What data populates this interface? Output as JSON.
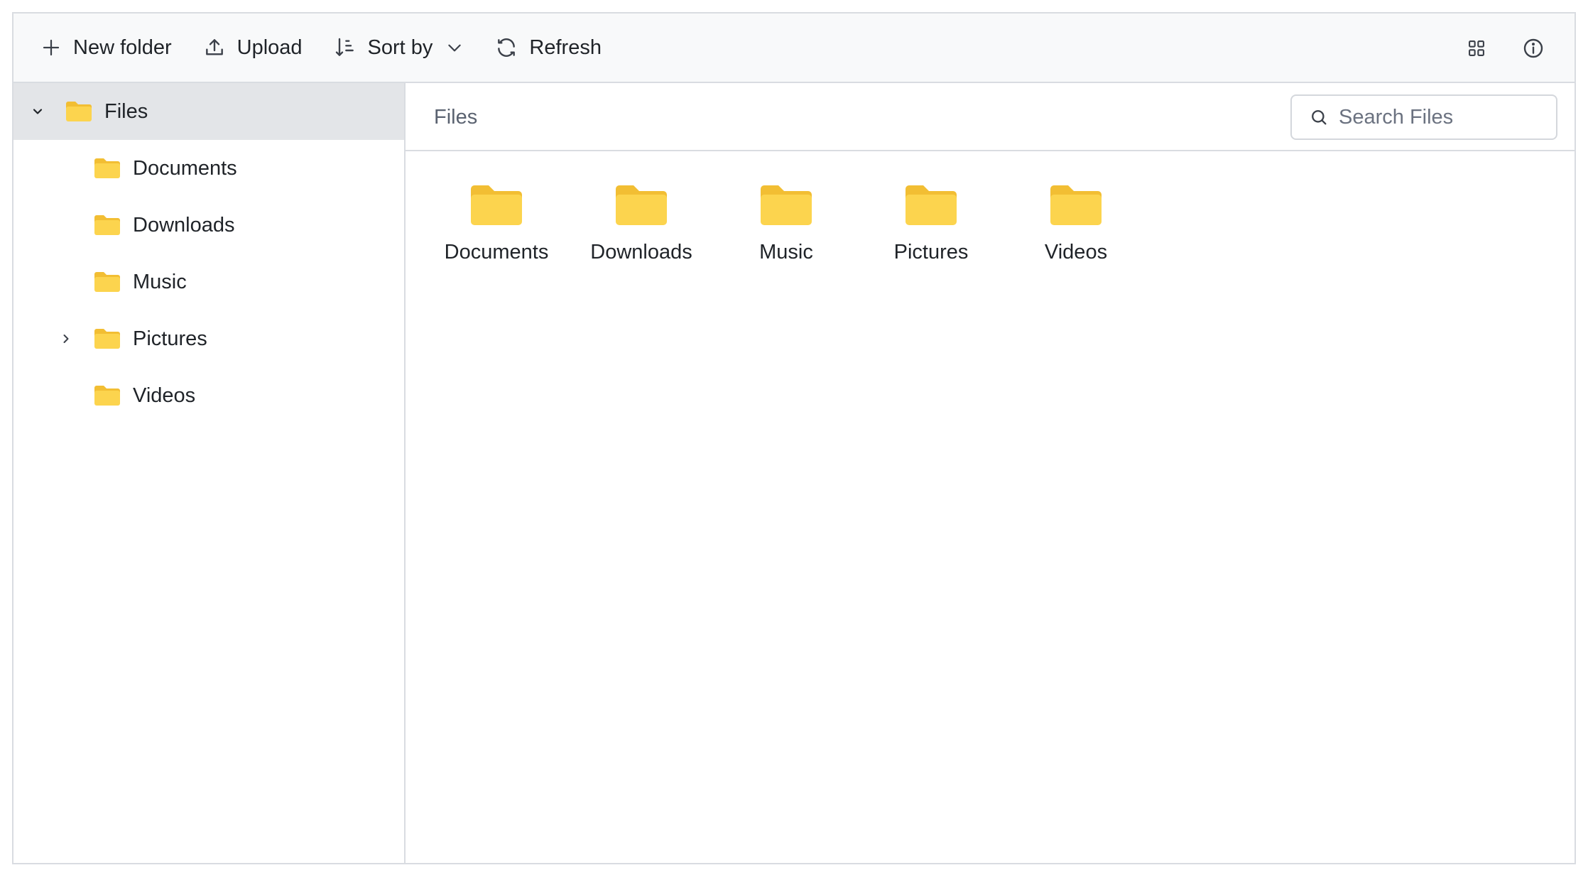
{
  "toolbar": {
    "new_folder_label": "New folder",
    "upload_label": "Upload",
    "sort_label": "Sort by",
    "refresh_label": "Refresh",
    "icons": [
      "plus-icon",
      "upload-icon",
      "sort-icon",
      "chevron-down-icon",
      "refresh-icon",
      "grid-view-icon",
      "info-icon"
    ]
  },
  "sidebar": {
    "root": {
      "label": "Files",
      "expanded": true,
      "selected": true
    },
    "items": [
      {
        "label": "Documents",
        "has_children": false
      },
      {
        "label": "Downloads",
        "has_children": false
      },
      {
        "label": "Music",
        "has_children": false
      },
      {
        "label": "Pictures",
        "has_children": true,
        "expanded": false
      },
      {
        "label": "Videos",
        "has_children": false
      }
    ]
  },
  "main": {
    "breadcrumb": "Files",
    "search": {
      "placeholder": "Search Files",
      "value": ""
    },
    "folders": [
      {
        "label": "Documents"
      },
      {
        "label": "Downloads"
      },
      {
        "label": "Music"
      },
      {
        "label": "Pictures"
      },
      {
        "label": "Videos"
      }
    ]
  },
  "colors": {
    "folder_front": "#FCD44E",
    "folder_back": "#F2BE33",
    "selected_row": "#E3E5E8",
    "toolbar_bg": "#F8F9FA",
    "border": "#D9DCE1"
  }
}
